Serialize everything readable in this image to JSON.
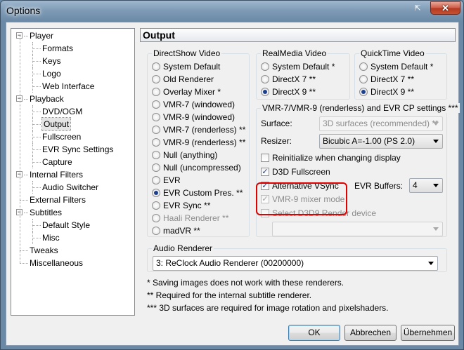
{
  "window": {
    "title": "Options"
  },
  "tree": {
    "items": [
      {
        "label": "Player",
        "level": 0,
        "expander": "−"
      },
      {
        "label": "Formats",
        "level": 1
      },
      {
        "label": "Keys",
        "level": 1
      },
      {
        "label": "Logo",
        "level": 1
      },
      {
        "label": "Web Interface",
        "level": 1
      },
      {
        "label": "Playback",
        "level": 0,
        "expander": "−"
      },
      {
        "label": "DVD/OGM",
        "level": 1
      },
      {
        "label": "Output",
        "level": 1,
        "selected": true
      },
      {
        "label": "Fullscreen",
        "level": 1
      },
      {
        "label": "EVR Sync Settings",
        "level": 1
      },
      {
        "label": "Capture",
        "level": 1
      },
      {
        "label": "Internal Filters",
        "level": 0,
        "expander": "−"
      },
      {
        "label": "Audio Switcher",
        "level": 1
      },
      {
        "label": "External Filters",
        "level": 0
      },
      {
        "label": "Subtitles",
        "level": 0,
        "expander": "−"
      },
      {
        "label": "Default Style",
        "level": 1
      },
      {
        "label": "Misc",
        "level": 1
      },
      {
        "label": "Tweaks",
        "level": 0
      },
      {
        "label": "Miscellaneous",
        "level": 0
      }
    ]
  },
  "page": {
    "title": "Output"
  },
  "directshow": {
    "label": "DirectShow Video",
    "options": [
      {
        "label": "System Default",
        "checked": false,
        "disabled": false
      },
      {
        "label": "Old Renderer",
        "checked": false,
        "disabled": false
      },
      {
        "label": "Overlay Mixer *",
        "checked": false,
        "disabled": false
      },
      {
        "label": "VMR-7 (windowed)",
        "checked": false,
        "disabled": false
      },
      {
        "label": "VMR-9 (windowed)",
        "checked": false,
        "disabled": false
      },
      {
        "label": "VMR-7 (renderless) **",
        "checked": false,
        "disabled": false
      },
      {
        "label": "VMR-9 (renderless) **",
        "checked": false,
        "disabled": false
      },
      {
        "label": "Null (anything)",
        "checked": false,
        "disabled": false
      },
      {
        "label": "Null (uncompressed)",
        "checked": false,
        "disabled": false
      },
      {
        "label": "EVR",
        "checked": false,
        "disabled": false
      },
      {
        "label": "EVR Custom Pres. **",
        "checked": true,
        "disabled": false
      },
      {
        "label": "EVR Sync **",
        "checked": false,
        "disabled": false
      },
      {
        "label": "Haali Renderer **",
        "checked": false,
        "disabled": true
      },
      {
        "label": "madVR **",
        "checked": false,
        "disabled": false
      }
    ]
  },
  "realmedia": {
    "label": "RealMedia Video",
    "options": [
      {
        "label": "System Default *",
        "checked": false
      },
      {
        "label": "DirectX 7 **",
        "checked": false
      },
      {
        "label": "DirectX 9 **",
        "checked": true
      }
    ]
  },
  "quicktime": {
    "label": "QuickTime Video",
    "options": [
      {
        "label": "System Default *",
        "checked": false
      },
      {
        "label": "DirectX 7 **",
        "checked": false
      },
      {
        "label": "DirectX 9 **",
        "checked": true
      }
    ]
  },
  "vmr": {
    "label": "VMR-7/VMR-9 (renderless) and EVR CP settings ***",
    "surface_label": "Surface:",
    "surface_value": "3D surfaces (recommended) **",
    "resizer_label": "Resizer:",
    "resizer_value": "Bicubic A=-1.00 (PS 2.0)",
    "reinit_label": "Reinitialize when changing display",
    "d3d_fullscreen_label": "D3D Fullscreen",
    "alt_vsync_label": "Alternative VSync",
    "evr_buffers_label": "EVR Buffers:",
    "evr_buffers_value": "4",
    "vmr9_mixer_label": "VMR-9 mixer mode",
    "select_d3d9_label": "Select D3D9 Render device",
    "select_d3d9_value": ""
  },
  "audio": {
    "label": "Audio Renderer",
    "value": "3: ReClock Audio Renderer (00200000)"
  },
  "notes": [
    "* Saving images does not work with these renderers.",
    "** Required for the internal subtitle renderer.",
    "*** 3D surfaces are required for image rotation and pixelshaders."
  ],
  "buttons": {
    "ok": "OK",
    "cancel": "Abbrechen",
    "apply": "Übernehmen"
  },
  "colors": {
    "highlight": "#e00000",
    "radio_dot": "#1c3f8e"
  }
}
